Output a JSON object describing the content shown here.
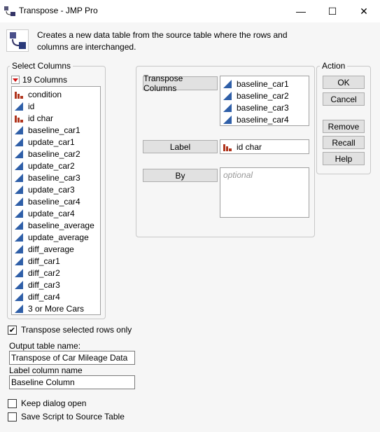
{
  "window": {
    "title": "Transpose - JMP Pro",
    "minimize": "—",
    "maximize": "☐",
    "close": "✕"
  },
  "description": [
    "Creates a new data table from the source table where the rows and",
    "columns are interchanged."
  ],
  "select_columns": {
    "title": "Select Columns",
    "count": "19 Columns",
    "items": [
      {
        "label": "condition",
        "type": "nominal"
      },
      {
        "label": "id",
        "type": "continuous"
      },
      {
        "label": "id char",
        "type": "nominal"
      },
      {
        "label": "baseline_car1",
        "type": "continuous"
      },
      {
        "label": "update_car1",
        "type": "continuous"
      },
      {
        "label": "baseline_car2",
        "type": "continuous"
      },
      {
        "label": "update_car2",
        "type": "continuous"
      },
      {
        "label": "baseline_car3",
        "type": "continuous"
      },
      {
        "label": "update_car3",
        "type": "continuous"
      },
      {
        "label": "baseline_car4",
        "type": "continuous"
      },
      {
        "label": "update_car4",
        "type": "continuous"
      },
      {
        "label": "baseline_average",
        "type": "continuous"
      },
      {
        "label": "update_average",
        "type": "continuous"
      },
      {
        "label": "diff_average",
        "type": "continuous"
      },
      {
        "label": "diff_car1",
        "type": "continuous"
      },
      {
        "label": "diff_car2",
        "type": "continuous"
      },
      {
        "label": "diff_car3",
        "type": "continuous"
      },
      {
        "label": "diff_car4",
        "type": "continuous"
      },
      {
        "label": "3 or More Cars",
        "type": "continuous"
      }
    ]
  },
  "roles": {
    "transpose_label": "Transpose Columns",
    "transpose_items": [
      "baseline_car1",
      "baseline_car2",
      "baseline_car3",
      "baseline_car4"
    ],
    "label_label": "Label",
    "label_item": "id char",
    "by_label": "By",
    "by_placeholder": "optional"
  },
  "action": {
    "title": "Action",
    "ok": "OK",
    "cancel": "Cancel",
    "remove": "Remove",
    "recall": "Recall",
    "help": "Help"
  },
  "options": {
    "transpose_selected": "Transpose selected rows only",
    "transpose_selected_checked": true,
    "output_label": "Output table name:",
    "output_value": "Transpose of Car Mileage Data",
    "labelcol_label": "Label column name",
    "labelcol_value": "Baseline Column",
    "keep_open": "Keep dialog open",
    "keep_open_checked": false,
    "save_script": "Save Script to Source Table",
    "save_script_checked": false
  },
  "colors": {
    "nominal": "#b0341c",
    "continuous": "#2f5fa8"
  }
}
